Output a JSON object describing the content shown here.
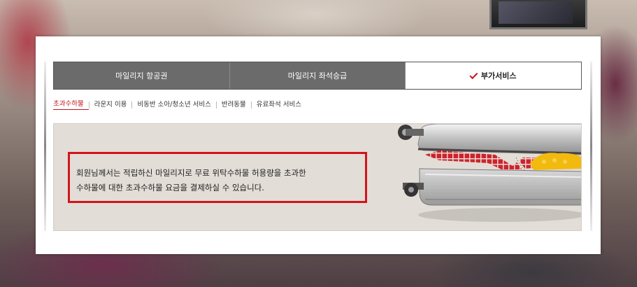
{
  "tabs": [
    {
      "label": "마일리지 항공권",
      "active": false
    },
    {
      "label": "마일리지 좌석승급",
      "active": false
    },
    {
      "label": "부가서비스",
      "active": true
    }
  ],
  "subnav": [
    {
      "label": "초과수하물",
      "active": true
    },
    {
      "label": "라운지 이용",
      "active": false
    },
    {
      "label": "비동반 소아/청소년 서비스",
      "active": false
    },
    {
      "label": "반려동물",
      "active": false
    },
    {
      "label": "유료좌석 서비스",
      "active": false
    }
  ],
  "notice": {
    "line1": "회원님께서는 적립하신 마일리지로 무료 위탁수하물 허용량을 초과한",
    "line2": "수하물에 대한 초과수하물 요금을 결제하실 수 있습니다."
  },
  "colors": {
    "accent": "#c3161c",
    "tab_inactive": "#6b6b6b",
    "panel_bg": "#e2ddd7"
  },
  "icons": {
    "active_tab": "check-icon",
    "illustration": "suitcase-illustration"
  }
}
